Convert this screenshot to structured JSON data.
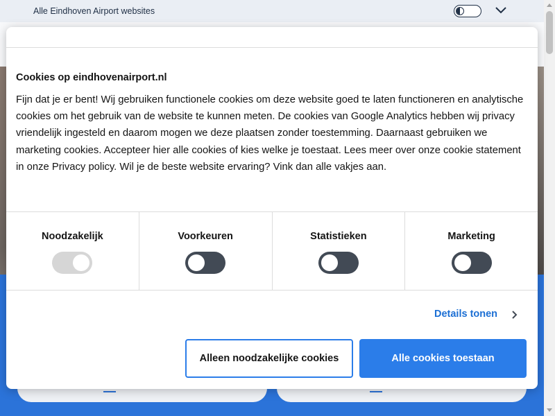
{
  "topbar": {
    "text": "Alle Eindhoven Airport websites",
    "contrast_icon": "contrast-toggle-icon",
    "chevron_icon": "chevron-down-icon"
  },
  "cookie_dialog": {
    "title": "Cookies op eindhovenairport.nl",
    "body": "Fijn dat je er bent! Wij gebruiken functionele cookies om deze website goed te laten functioneren en analytische cookies om het gebruik van de website te kunnen meten. De cookies van Google Analytics hebben wij privacy vriendelijk ingesteld en daarom mogen we deze plaatsen zonder toestemming. Daarnaast gebruiken we marketing cookies. Accepteer hier alle cookies of kies welke je toestaat. Lees meer over onze cookie statement in onze Privacy policy. Wil je de beste website ervaring? Vink dan alle vakjes aan.",
    "categories": [
      {
        "label": "Noodzakelijk",
        "enabled": true,
        "locked": true
      },
      {
        "label": "Voorkeuren",
        "enabled": false,
        "locked": false
      },
      {
        "label": "Statistieken",
        "enabled": false,
        "locked": false
      },
      {
        "label": "Marketing",
        "enabled": false,
        "locked": false
      }
    ],
    "details_label": "Details tonen",
    "necessary_button_label": "Alleen noodzakelijke cookies",
    "allow_all_button_label": "Alle cookies toestaan"
  },
  "colors": {
    "accent": "#2b7de9",
    "link": "#1c6fd4",
    "switch_off": "#424a55",
    "switch_locked": "#d6d6d6",
    "page_blue": "#2b73d9"
  }
}
